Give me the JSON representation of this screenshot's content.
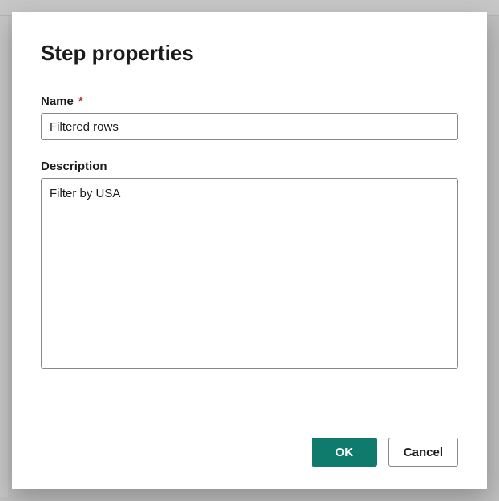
{
  "dialog": {
    "title": "Step properties",
    "name_field": {
      "label": "Name",
      "required_mark": "*",
      "value": "Filtered rows"
    },
    "description_field": {
      "label": "Description",
      "value": "Filter by USA"
    },
    "buttons": {
      "ok": "OK",
      "cancel": "Cancel"
    }
  }
}
